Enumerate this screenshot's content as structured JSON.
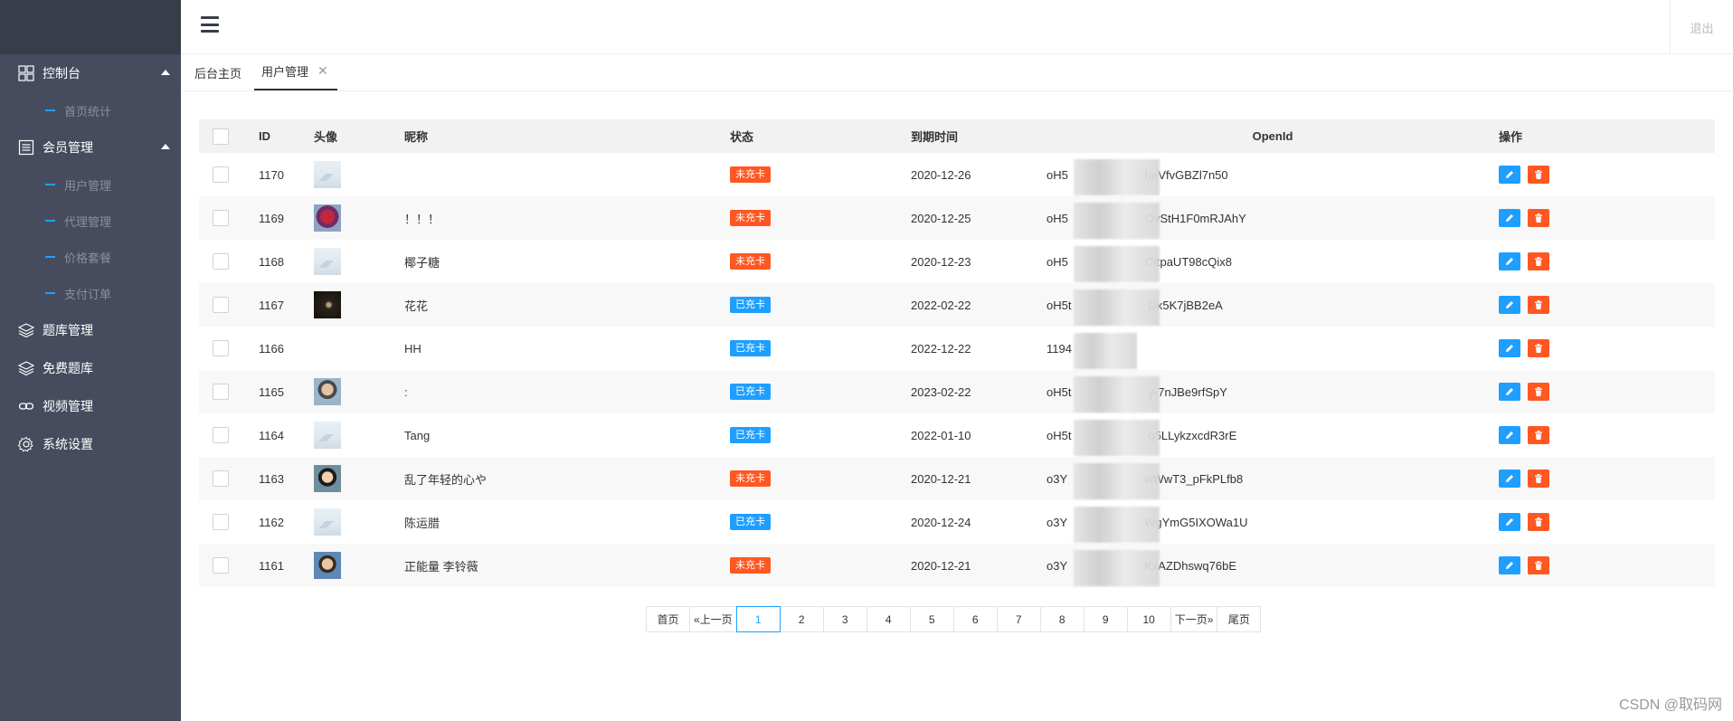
{
  "sidebar": {
    "groups": [
      {
        "label": "控制台",
        "icon": "dashboard-icon",
        "subs": [
          "首页统计"
        ]
      },
      {
        "label": "会员管理",
        "icon": "list-icon",
        "subs": [
          "用户管理",
          "代理管理",
          "价格套餐",
          "支付订单"
        ]
      },
      {
        "label": "题库管理",
        "icon": "layers-icon"
      },
      {
        "label": "免费题库",
        "icon": "layers-icon"
      },
      {
        "label": "视频管理",
        "icon": "link-icon"
      },
      {
        "label": "系统设置",
        "icon": "gear-icon"
      }
    ]
  },
  "header": {
    "logout": "退出"
  },
  "tabs": [
    {
      "label": "后台主页"
    },
    {
      "label": "用户管理",
      "close": "✕"
    }
  ],
  "table": {
    "headers": {
      "id": "ID",
      "avatar": "头像",
      "nickname": "昵称",
      "status": "状态",
      "expire": "到期时间",
      "openid": "OpenId",
      "action": "操作"
    },
    "rows": [
      {
        "id": "1170",
        "avatar": "default",
        "nickname": "",
        "status": "未充卡",
        "status_color": "#ff5722",
        "expire": "2020-12-26",
        "openid_pre": "oH5",
        "openid_suf": "heVfvGBZl7n50"
      },
      {
        "id": "1169",
        "avatar": "robot",
        "nickname": "！！！",
        "status": "未充卡",
        "status_color": "#ff5722",
        "expire": "2020-12-25",
        "openid_pre": "oH5",
        "openid_suf": "OvStH1F0mRJAhY"
      },
      {
        "id": "1168",
        "avatar": "default",
        "nickname": "椰子糖",
        "status": "未充卡",
        "status_color": "#ff5722",
        "expire": "2020-12-23",
        "openid_pre": "oH5",
        "openid_suf": "CttpaUT98cQix8"
      },
      {
        "id": "1167",
        "avatar": "night",
        "nickname": "花花",
        "status": "已充卡",
        "status_color": "#1e9fff",
        "expire": "2022-02-22",
        "openid_pre": "oH5t",
        "openid_suf": "Dx5K7jBB2eA"
      },
      {
        "id": "1166",
        "avatar": "none",
        "nickname": "HH",
        "status": "已充卡",
        "status_color": "#1e9fff",
        "expire": "2022-12-22",
        "openid_pre": "1194",
        "openid_suf": ""
      },
      {
        "id": "1165",
        "avatar": "face1",
        "nickname": ":",
        "status": "已充卡",
        "status_color": "#1e9fff",
        "expire": "2023-02-22",
        "openid_pre": "oH5t",
        "openid_suf": "y-7nJBe9rfSpY"
      },
      {
        "id": "1164",
        "avatar": "default",
        "nickname": "Tang",
        "status": "已充卡",
        "status_color": "#1e9fff",
        "expire": "2022-01-10",
        "openid_pre": "oH5t",
        "openid_suf": "q5LLykzxcdR3rE"
      },
      {
        "id": "1163",
        "avatar": "face2",
        "nickname": "乱了年轻的心や",
        "status": "未充卡",
        "status_color": "#ff5722",
        "expire": "2020-12-21",
        "openid_pre": "o3Y",
        "openid_suf": "wWwT3_pFkPLfb8"
      },
      {
        "id": "1162",
        "avatar": "default",
        "nickname": "陈运腊",
        "status": "已充卡",
        "status_color": "#1e9fff",
        "expire": "2020-12-24",
        "openid_pre": "o3Y",
        "openid_suf": "WgYmG5IXOWa1U"
      },
      {
        "id": "1161",
        "avatar": "face3",
        "nickname": "正能量 李铃薇",
        "status": "未充卡",
        "status_color": "#ff5722",
        "expire": "2020-12-21",
        "openid_pre": "o3Y",
        "openid_suf": "KxAZDhswq76bE"
      }
    ]
  },
  "pagination": {
    "first": "首页",
    "prev": "«上一页",
    "pages": [
      "1",
      "2",
      "3",
      "4",
      "5",
      "6",
      "7",
      "8",
      "9",
      "10"
    ],
    "current": "1",
    "next": "下一页»",
    "last": "尾页"
  },
  "watermark": "CSDN @取码网",
  "colors": {
    "sidebar_bg": "#464c5e",
    "sidebar_top": "#393d49",
    "accent_blue": "#1e9fff",
    "accent_orange": "#ff5722"
  }
}
